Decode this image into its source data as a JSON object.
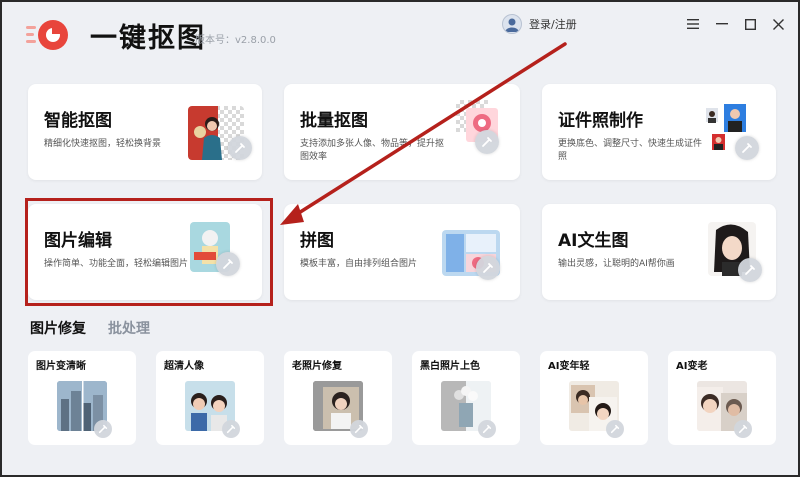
{
  "header": {
    "app_name": "一键抠图",
    "version": "版本号：v2.8.0.0",
    "login_label": "登录/注册",
    "window_controls": [
      "menu-icon",
      "minimize-icon",
      "maximize-icon",
      "close-icon"
    ]
  },
  "feature_cards": [
    {
      "title": "智能抠图",
      "desc": "精细化快速抠图，轻松换背景",
      "icon": "portrait-cutout-icon"
    },
    {
      "title": "批量抠图",
      "desc": "支持添加多张人像、物品等，提升抠图效率",
      "icon": "batch-cutout-icon"
    },
    {
      "title": "证件照制作",
      "desc": "更换底色、调整尺寸、快速生成证件照",
      "icon": "id-photo-icon"
    },
    {
      "title": "图片编辑",
      "desc": "操作简单、功能全面，轻松编辑图片",
      "icon": "image-edit-icon"
    },
    {
      "title": "拼图",
      "desc": "模板丰富，自由排列组合图片",
      "icon": "collage-icon"
    },
    {
      "title": "AI文生图",
      "desc": "输出灵感，让聪明的AI帮你画",
      "icon": "ai-text-to-image-icon"
    }
  ],
  "sections": {
    "tabs": [
      {
        "label": "图片修复",
        "active": true
      },
      {
        "label": "批处理",
        "active": false
      }
    ]
  },
  "repair_cards": [
    {
      "title": "图片变清晰",
      "icon": "enhance-icon"
    },
    {
      "title": "超清人像",
      "icon": "hd-portrait-icon"
    },
    {
      "title": "老照片修复",
      "icon": "old-photo-icon"
    },
    {
      "title": "黑白照片上色",
      "icon": "colorize-icon"
    },
    {
      "title": "AI变年轻",
      "icon": "ai-younger-icon"
    },
    {
      "title": "AI变老",
      "icon": "ai-older-icon"
    }
  ],
  "colors": {
    "brand_red": "#e8453c",
    "highlight_red": "#b5211c",
    "active_tab": "#111111",
    "inactive_tab": "#8a929e"
  }
}
